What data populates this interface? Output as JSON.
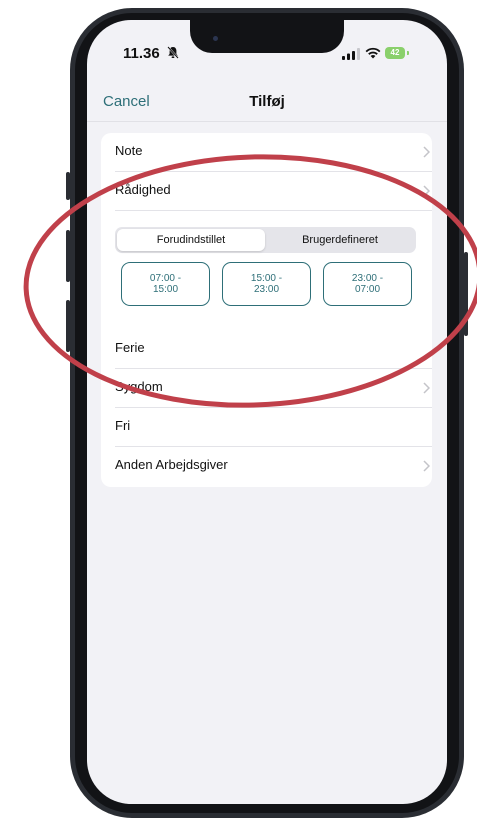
{
  "status_bar": {
    "time": "11.36",
    "battery": "42"
  },
  "nav": {
    "cancel_label": "Cancel",
    "title": "Tilføj"
  },
  "rows": {
    "note": "Note",
    "availability": "Rådighed",
    "vacation": "Ferie",
    "sickness": "Sygdom",
    "off": "Fri",
    "other_employer": "Anden Arbejdsgiver"
  },
  "segmented_control": {
    "options": [
      "Forudindstillet",
      "Brugerdefineret"
    ],
    "selected": "Forudindstillet"
  },
  "shifts": [
    {
      "line1": "07:00 -",
      "line2": "15:00"
    },
    {
      "line1": "15:00 -",
      "line2": "23:00"
    },
    {
      "line1": "23:00 -",
      "line2": "07:00"
    }
  ],
  "colors": {
    "accent": "#2e6f78",
    "annotation": "#c0404a",
    "background": "#f2f2f6"
  }
}
